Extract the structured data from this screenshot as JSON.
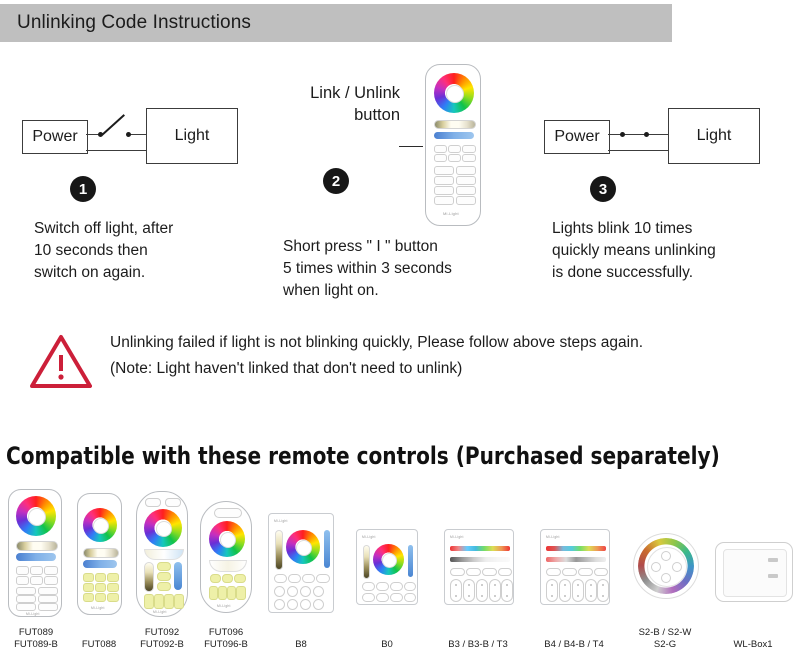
{
  "header": {
    "title": "Unlinking Code Instructions",
    "bar_color": "#bfbfbf"
  },
  "steps": [
    {
      "number": "1",
      "power_label": "Power",
      "light_label": "Light",
      "switch_state": "open",
      "text": "Switch off light, after\n10 seconds then\nswitch on again."
    },
    {
      "number": "2",
      "pointer_label": "Link / Unlink\nbutton",
      "text": "Short press \"  I  \" button\n5 times within 3 seconds\nwhen light on."
    },
    {
      "number": "3",
      "power_label": "Power",
      "light_label": "Light",
      "switch_state": "closed",
      "text": "Lights blink 10 times\nquickly means unlinking\nis done successfully."
    }
  ],
  "warning": {
    "icon": "warning-triangle",
    "color": "#cc1f39",
    "line1": "Unlinking failed if light is not blinking quickly, Please follow above steps again.",
    "line2": "(Note: Light haven't linked that don't need to unlink)"
  },
  "compatible": {
    "heading": "Compatible with these remote controls (Purchased separately)",
    "items": [
      {
        "label": "FUT089\nFUT089-B",
        "type": "remote-tall"
      },
      {
        "label": "FUT088",
        "type": "remote-slim"
      },
      {
        "label": "FUT092\nFUT092-B",
        "type": "remote-oval"
      },
      {
        "label": "FUT096\nFUT096-B",
        "type": "remote-round"
      },
      {
        "label": "B8",
        "type": "panel-wheel-big"
      },
      {
        "label": "B0",
        "type": "panel-wheel-small"
      },
      {
        "label": "B3 / B3-B / T3",
        "type": "panel-strips-3"
      },
      {
        "label": "B4 / B4-B / T4",
        "type": "panel-strips-4"
      },
      {
        "label": "S2-B / S2-W\nS2-G",
        "type": "round-dimmer"
      },
      {
        "label": "WL-Box1",
        "type": "wifi-box"
      }
    ],
    "brand_mark": "Mi-Light"
  }
}
